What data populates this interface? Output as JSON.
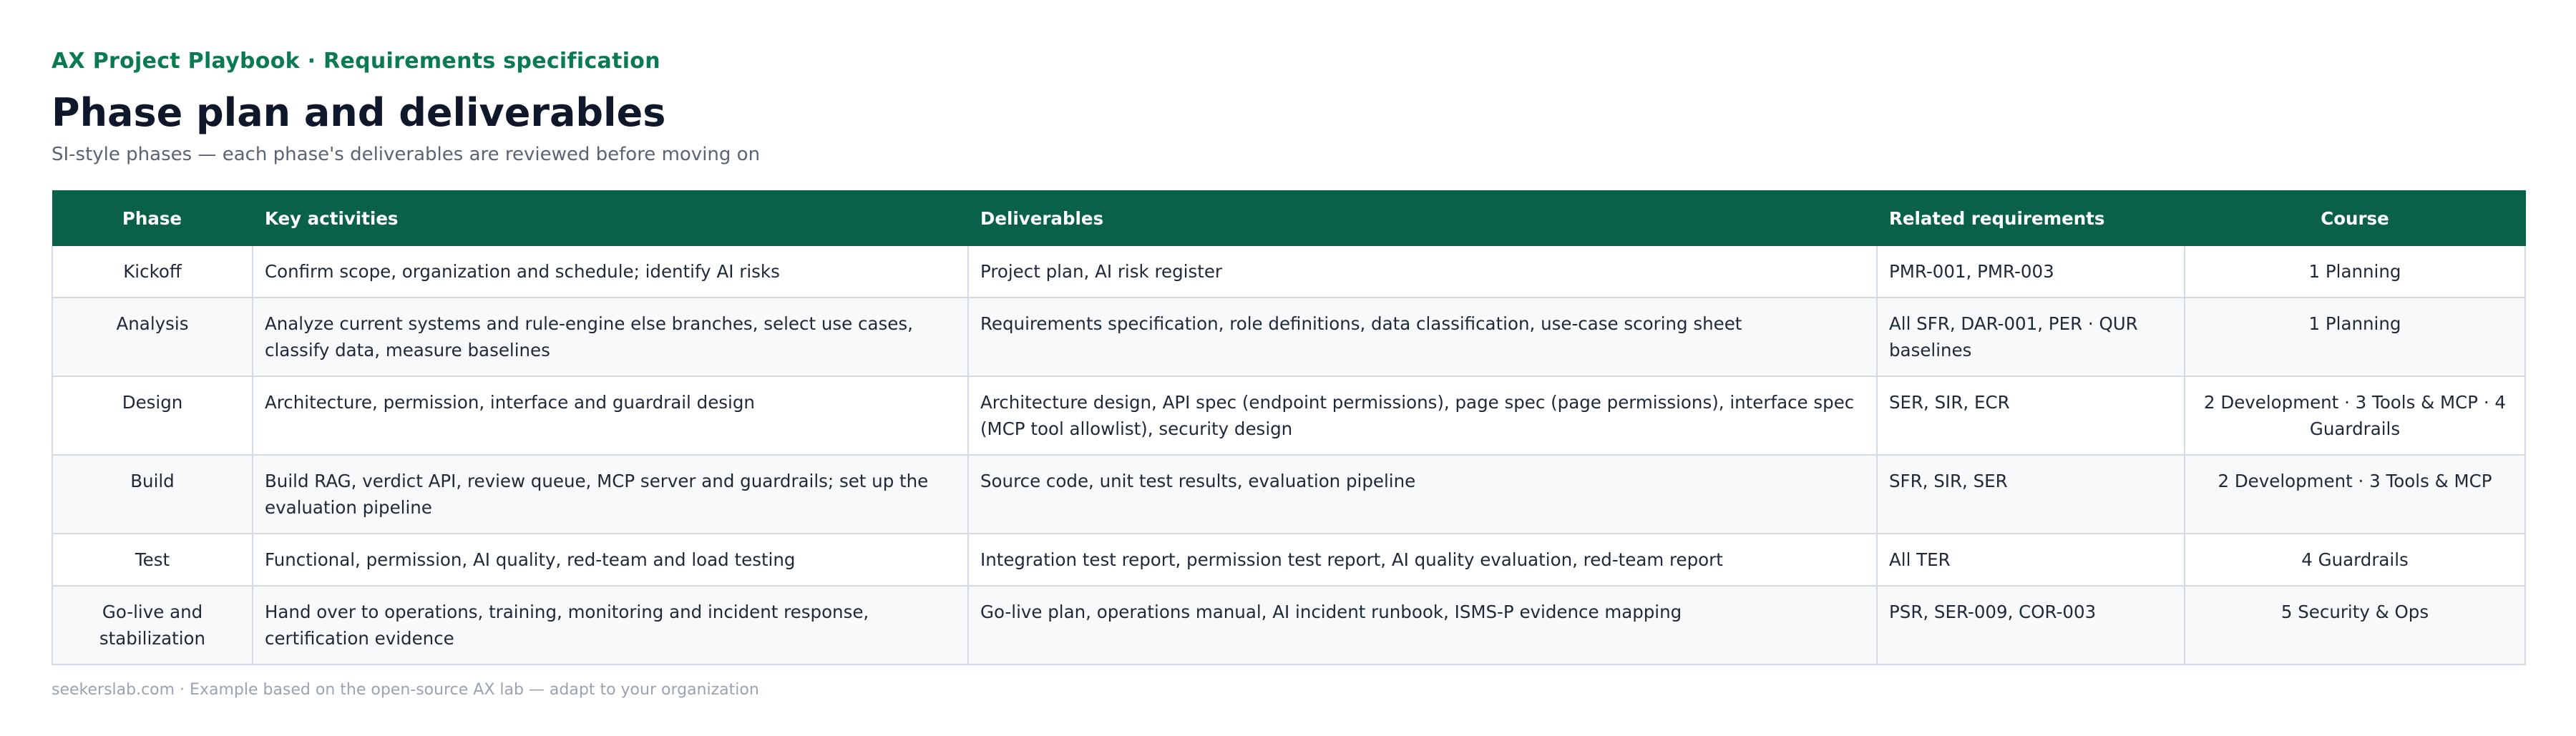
{
  "header": {
    "eyebrow": "AX Project Playbook · Requirements specification",
    "title": "Phase plan and deliverables",
    "subtitle": "SI-style phases — each phase's deliverables are reviewed before moving on"
  },
  "table": {
    "columns": [
      "Phase",
      "Key activities",
      "Deliverables",
      "Related requirements",
      "Course"
    ],
    "rows": [
      {
        "phase": "Kickoff",
        "activities": "Confirm scope, organization and schedule; identify AI risks",
        "deliverables": "Project plan, AI risk register",
        "requirements": "PMR-001, PMR-003",
        "course": "1 Planning"
      },
      {
        "phase": "Analysis",
        "activities": "Analyze current systems and rule-engine else branches, select use cases, classify data, measure baselines",
        "deliverables": "Requirements specification, role definitions, data classification, use-case scoring sheet",
        "requirements": "All SFR, DAR-001, PER · QUR baselines",
        "course": "1 Planning"
      },
      {
        "phase": "Design",
        "activities": "Architecture, permission, interface and guardrail design",
        "deliverables": "Architecture design, API spec (endpoint permissions), page spec (page permissions), interface spec (MCP tool allowlist), security design",
        "requirements": "SER, SIR, ECR",
        "course": "2 Development · 3 Tools & MCP · 4 Guardrails"
      },
      {
        "phase": "Build",
        "activities": "Build RAG, verdict API, review queue, MCP server and guardrails; set up the evaluation pipeline",
        "deliverables": "Source code, unit test results, evaluation pipeline",
        "requirements": "SFR, SIR, SER",
        "course": "2 Development · 3 Tools & MCP"
      },
      {
        "phase": "Test",
        "activities": "Functional, permission, AI quality, red-team and load testing",
        "deliverables": "Integration test report, permission test report, AI quality evaluation, red-team report",
        "requirements": "All TER",
        "course": "4 Guardrails"
      },
      {
        "phase": "Go-live and stabilization",
        "activities": "Hand over to operations, training, monitoring and incident response, certification evidence",
        "deliverables": "Go-live plan, operations manual, AI incident runbook, ISMS-P evidence mapping",
        "requirements": "PSR, SER-009, COR-003",
        "course": "5 Security & Ops"
      }
    ]
  },
  "footer": {
    "text": "seekerslab.com · Example based on the open-source AX lab — adapt to your organization"
  }
}
